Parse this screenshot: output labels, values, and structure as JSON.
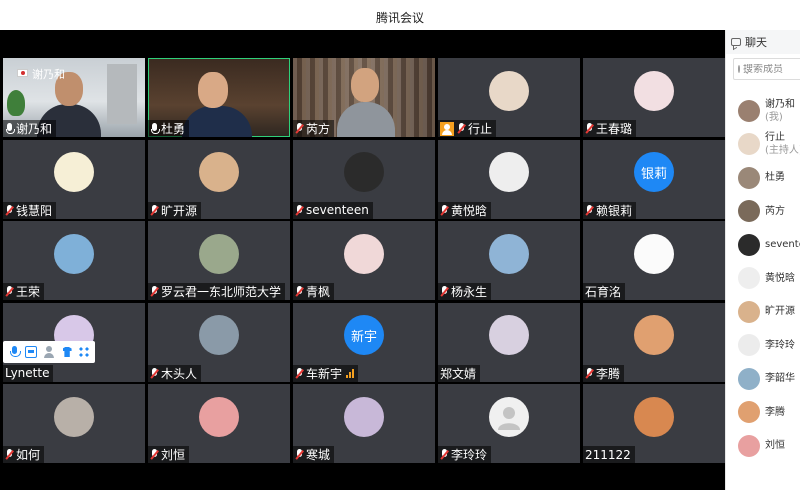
{
  "window": {
    "title": "腾讯会议"
  },
  "main_speaker": {
    "label": "谢乃和"
  },
  "participants": [
    {
      "name": "谢乃和",
      "mic": "on",
      "kind": "cam1"
    },
    {
      "name": "杜勇",
      "mic": "on",
      "kind": "cam2",
      "active": true
    },
    {
      "name": "芮方",
      "mic": "off",
      "kind": "cam3"
    },
    {
      "name": "行止",
      "mic": "off",
      "kind": "avatar",
      "avatar_icon": "cat-photo-icon",
      "avatar_color": "#e8d8c8",
      "host_badge": true
    },
    {
      "name": "王春璐",
      "mic": "off",
      "kind": "avatar",
      "avatar_icon": "anime-girl-icon",
      "avatar_color": "#f2dfe2"
    },
    {
      "name": "钱慧阳",
      "mic": "off",
      "kind": "avatar",
      "avatar_icon": "cartoon-animals-icon",
      "avatar_color": "#f6efd6"
    },
    {
      "name": "旷开源",
      "mic": "off",
      "kind": "avatar",
      "avatar_icon": "dog-photo-icon",
      "avatar_color": "#d9b28c"
    },
    {
      "name": "seventeen",
      "mic": "off",
      "kind": "avatar",
      "avatar_icon": "coffee-cup-icon",
      "avatar_color": "#2b2b2b"
    },
    {
      "name": "黄悦晗",
      "mic": "off",
      "kind": "avatar",
      "avatar_icon": "white-hair-anime-icon",
      "avatar_color": "#eeeeee"
    },
    {
      "name": "赖银莉",
      "mic": "off",
      "kind": "text",
      "avatar_text": "银莉"
    },
    {
      "name": "王荣",
      "mic": "off",
      "kind": "avatar",
      "avatar_icon": "cartoon-boy-icon",
      "avatar_color": "#7fb0d8"
    },
    {
      "name": "罗云君一东北师范大学",
      "mic": "off",
      "kind": "avatar",
      "avatar_icon": "tree-landscape-icon",
      "avatar_color": "#9aa88c"
    },
    {
      "name": "青枫",
      "mic": "off",
      "kind": "avatar",
      "avatar_icon": "pattern-icon",
      "avatar_color": "#f0d8d8"
    },
    {
      "name": "杨永生",
      "mic": "off",
      "kind": "avatar",
      "avatar_icon": "lake-landscape-icon",
      "avatar_color": "#8fb4d6"
    },
    {
      "name": "石育洺",
      "mic": "none",
      "kind": "avatar",
      "avatar_icon": "white-cat-cartoon-icon",
      "avatar_color": "#fbfbfb"
    },
    {
      "name": "Lynette",
      "mic": "none",
      "kind": "avatar",
      "avatar_icon": "purple-anime-icon",
      "avatar_color": "#d8c8e8"
    },
    {
      "name": "木头人",
      "mic": "off",
      "kind": "avatar",
      "avatar_icon": "boy-portrait-icon",
      "avatar_color": "#8a9aa8"
    },
    {
      "name": "车新宇",
      "mic": "off",
      "kind": "text",
      "avatar_text": "新宇",
      "signal": true
    },
    {
      "name": "郑文婧",
      "mic": "none",
      "kind": "avatar",
      "avatar_icon": "figurine-icon",
      "avatar_color": "#d8d0e0"
    },
    {
      "name": "李腾",
      "mic": "off",
      "kind": "avatar",
      "avatar_icon": "sunset-icon",
      "avatar_color": "#e0a070"
    },
    {
      "name": "如何",
      "mic": "off",
      "kind": "avatar",
      "avatar_icon": "girl-photo-icon",
      "avatar_color": "#b8b0a8"
    },
    {
      "name": "刘恒",
      "mic": "off",
      "kind": "avatar",
      "avatar_icon": "flower-pattern-icon",
      "avatar_color": "#e8a0a0"
    },
    {
      "name": "寒城",
      "mic": "off",
      "kind": "avatar",
      "avatar_icon": "anime-girl-purple-icon",
      "avatar_color": "#c8b8d8"
    },
    {
      "name": "李玲玲",
      "mic": "off",
      "kind": "placeholder"
    },
    {
      "name": "211122",
      "mic": "none",
      "kind": "avatar",
      "avatar_icon": "sunset-rider-icon",
      "avatar_color": "#d88850"
    }
  ],
  "sidebar": {
    "chat_label": "聊天",
    "search_placeholder": "搜索成员",
    "members": [
      {
        "name": "谢乃和",
        "sub": "(我)",
        "avatar_color": "#9a8070"
      },
      {
        "name": "行止",
        "sub": "(主持人)",
        "avatar_color": "#e8d8c8"
      },
      {
        "name": "杜勇",
        "sub": "",
        "avatar_color": "#9a8878"
      },
      {
        "name": "芮方",
        "sub": "",
        "avatar_color": "#7a6a5a"
      },
      {
        "name": "seventeen",
        "sub": "",
        "avatar_color": "#2b2b2b"
      },
      {
        "name": "黄悦晗",
        "sub": "",
        "avatar_color": "#eeeeee"
      },
      {
        "name": "旷开源",
        "sub": "",
        "avatar_color": "#d9b28c"
      },
      {
        "name": "李玲玲",
        "sub": "",
        "avatar_color": "#ececec"
      },
      {
        "name": "李韶华",
        "sub": "",
        "avatar_color": "#8fb0c8"
      },
      {
        "name": "李腾",
        "sub": "",
        "avatar_color": "#e0a070"
      },
      {
        "name": "刘恒",
        "sub": "",
        "avatar_color": "#e8a0a0"
      }
    ]
  }
}
